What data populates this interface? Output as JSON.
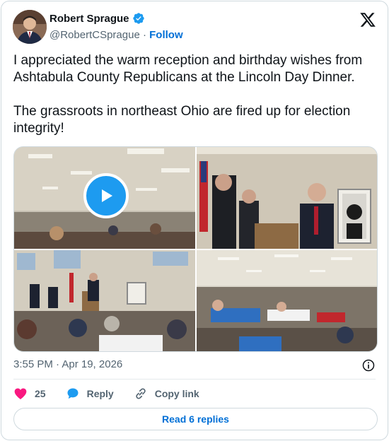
{
  "author": {
    "name": "Robert Sprague",
    "handle": "@RobertCSprague",
    "separator": " · ",
    "follow_label": "Follow"
  },
  "tweet": {
    "text": "I appreciated the warm reception and birthday wishes from Ashtabula County Republicans at the Lincoln Day Dinner.\n\nThe grassroots in northeast Ohio are fired up for election integrity!"
  },
  "media": {
    "items": [
      {
        "kind": "video",
        "icon": "play-icon"
      },
      {
        "kind": "photo"
      },
      {
        "kind": "photo"
      },
      {
        "kind": "photo"
      }
    ]
  },
  "meta": {
    "timestamp": "3:55 PM · Apr 19, 2026"
  },
  "actions": {
    "like_count": "25",
    "reply_label": "Reply",
    "copy_link_label": "Copy link"
  },
  "footer": {
    "read_replies_label": "Read 6 replies"
  },
  "colors": {
    "accent": "#1d9bf0",
    "link": "#006fd6",
    "like": "#f91880",
    "muted": "#536471",
    "text": "#0f1419",
    "border": "#cfd9de"
  }
}
